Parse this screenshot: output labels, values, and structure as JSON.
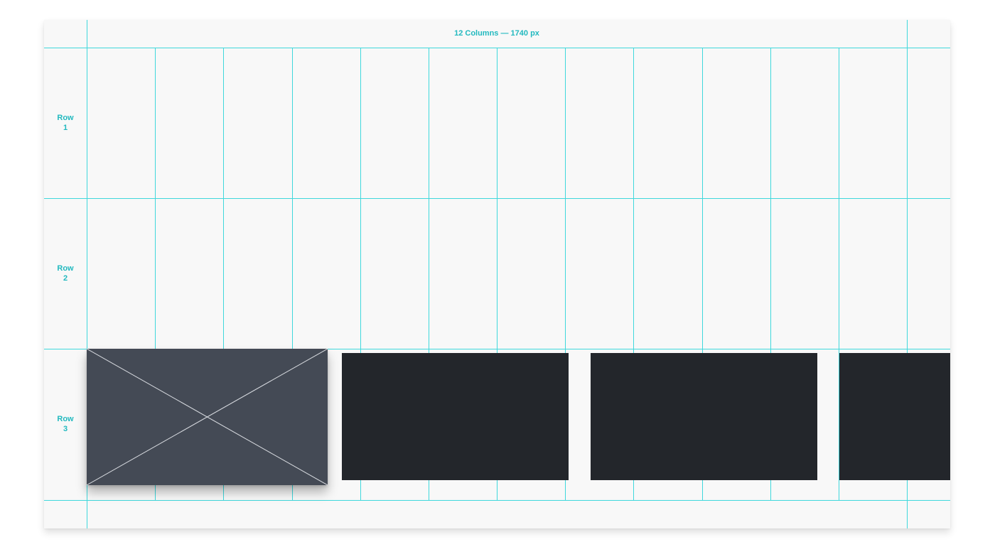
{
  "grid": {
    "columns_label": "12 Columns — 1740 px",
    "column_count": 12,
    "rows": [
      {
        "label_word": "Row",
        "label_num": "1"
      },
      {
        "label_word": "Row",
        "label_num": "2"
      },
      {
        "label_word": "Row",
        "label_num": "3"
      }
    ],
    "line_color": "#3fd8dc",
    "label_color": "#22b9bf",
    "background_color": "#f8f8f8"
  },
  "content": {
    "placeholder": {
      "type": "image-placeholder",
      "color": "#444a55"
    },
    "cards_color": "#23262b",
    "card_count": 3
  }
}
